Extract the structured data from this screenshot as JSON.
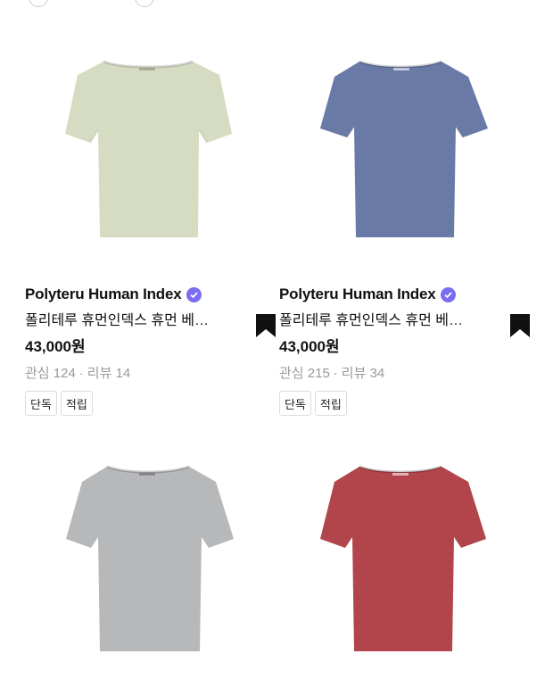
{
  "products": [
    {
      "brand": "Polyteru Human Index",
      "name": "폴리테루 휴먼인덱스 휴먼 베…",
      "price": "43,000원",
      "likes_label": "관심 124",
      "reviews_label": "리뷰 14",
      "badges": [
        "단독",
        "적립"
      ],
      "shirt_color": "#d5dcc2"
    },
    {
      "brand": "Polyteru Human Index",
      "name": "폴리테루 휴먼인덱스 휴먼 베…",
      "price": "43,000원",
      "likes_label": "관심 215",
      "reviews_label": "리뷰 34",
      "badges": [
        "단독",
        "적립"
      ],
      "shirt_color": "#6a7aa6"
    },
    {
      "shirt_color": "#b7b8ba"
    },
    {
      "shirt_color": "#b2454b"
    }
  ],
  "stats_separator": "·",
  "icons": {
    "verified": "verified-check-icon",
    "bookmark": "bookmark-icon"
  },
  "colors": {
    "verified": "#7b6cf0",
    "muted_text": "#9a9a9a",
    "bookmark": "#111111"
  }
}
